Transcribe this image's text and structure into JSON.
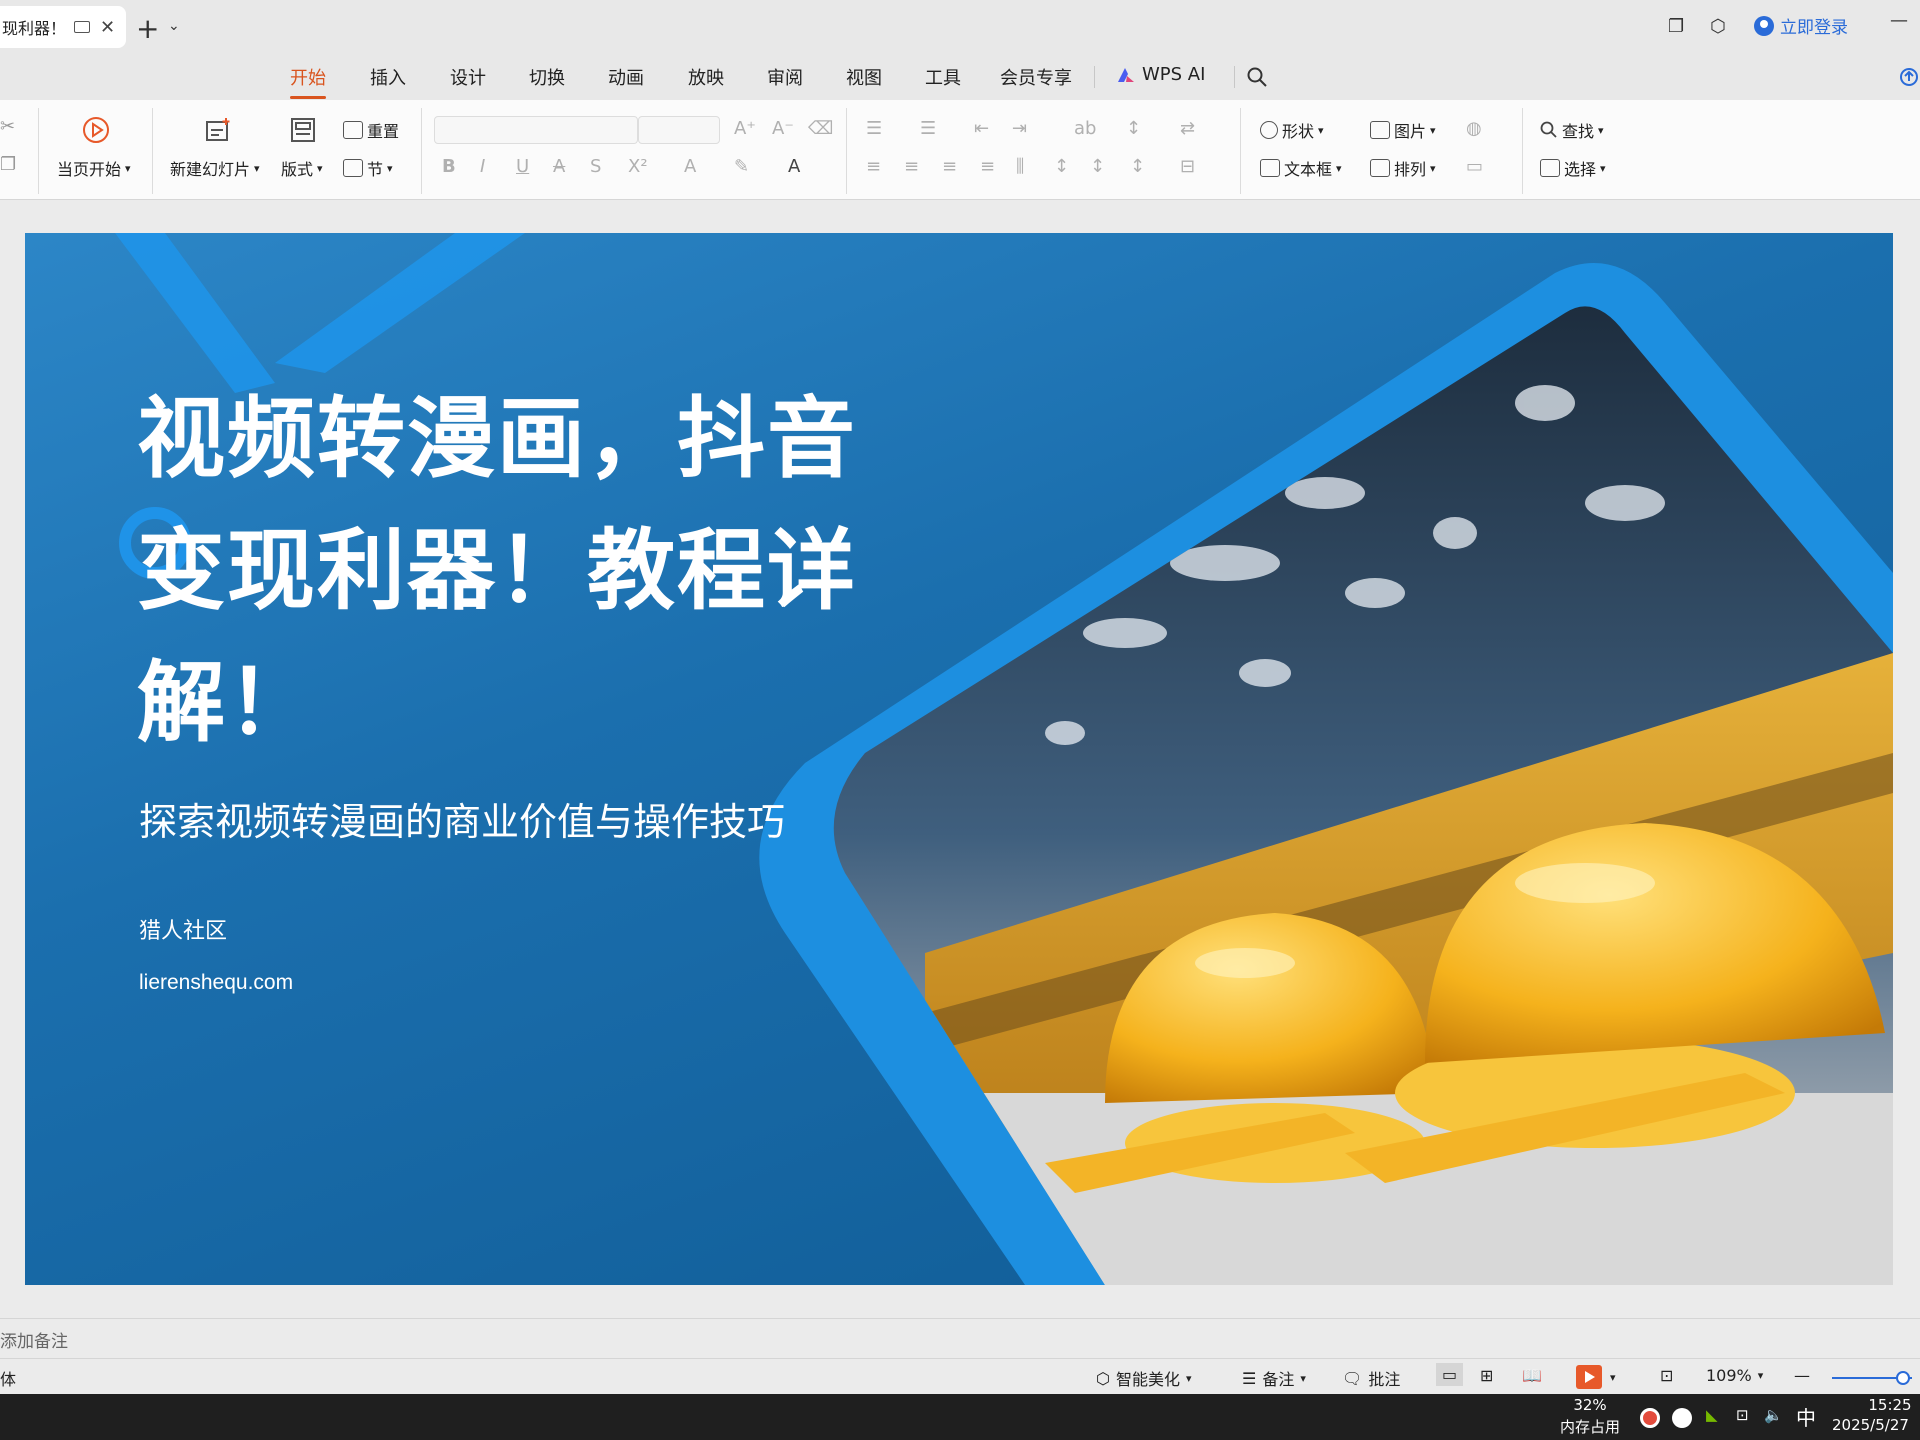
{
  "titlebar": {
    "tab_title": "现利器！",
    "login_label": "立即登录"
  },
  "menu": {
    "tabs": [
      "开始",
      "插入",
      "设计",
      "切换",
      "动画",
      "放映",
      "审阅",
      "视图",
      "工具",
      "会员专享"
    ],
    "active": "开始",
    "wps_ai": "WPS AI"
  },
  "ribbon": {
    "from_current": "当页开始",
    "new_slide": "新建幻灯片",
    "layout": "版式",
    "reset": "重置",
    "section": "节",
    "shape": "形状",
    "picture": "图片",
    "textbox": "文本框",
    "arrange": "排列",
    "find": "查找",
    "select": "选择"
  },
  "slide": {
    "title": "视频转漫画，抖音变现利器！教程详解！",
    "subtitle": "探索视频转漫画的商业价值与操作技巧",
    "org": "猎人社区",
    "url": "lierenshequ.com"
  },
  "notes": {
    "placeholder": "添加备注"
  },
  "statusbar": {
    "left_text": "体",
    "beautify": "智能美化",
    "notes": "备注",
    "comments": "批注",
    "zoom": "109%"
  },
  "taskbar": {
    "memory_percent": "32%",
    "memory_label": "内存占用",
    "ime": "中",
    "time": "15:25",
    "date": "2025/5/27"
  },
  "colors": {
    "accent": "#d9541e",
    "link": "#2a6bd8",
    "slide_bg": "#1b6fae"
  }
}
